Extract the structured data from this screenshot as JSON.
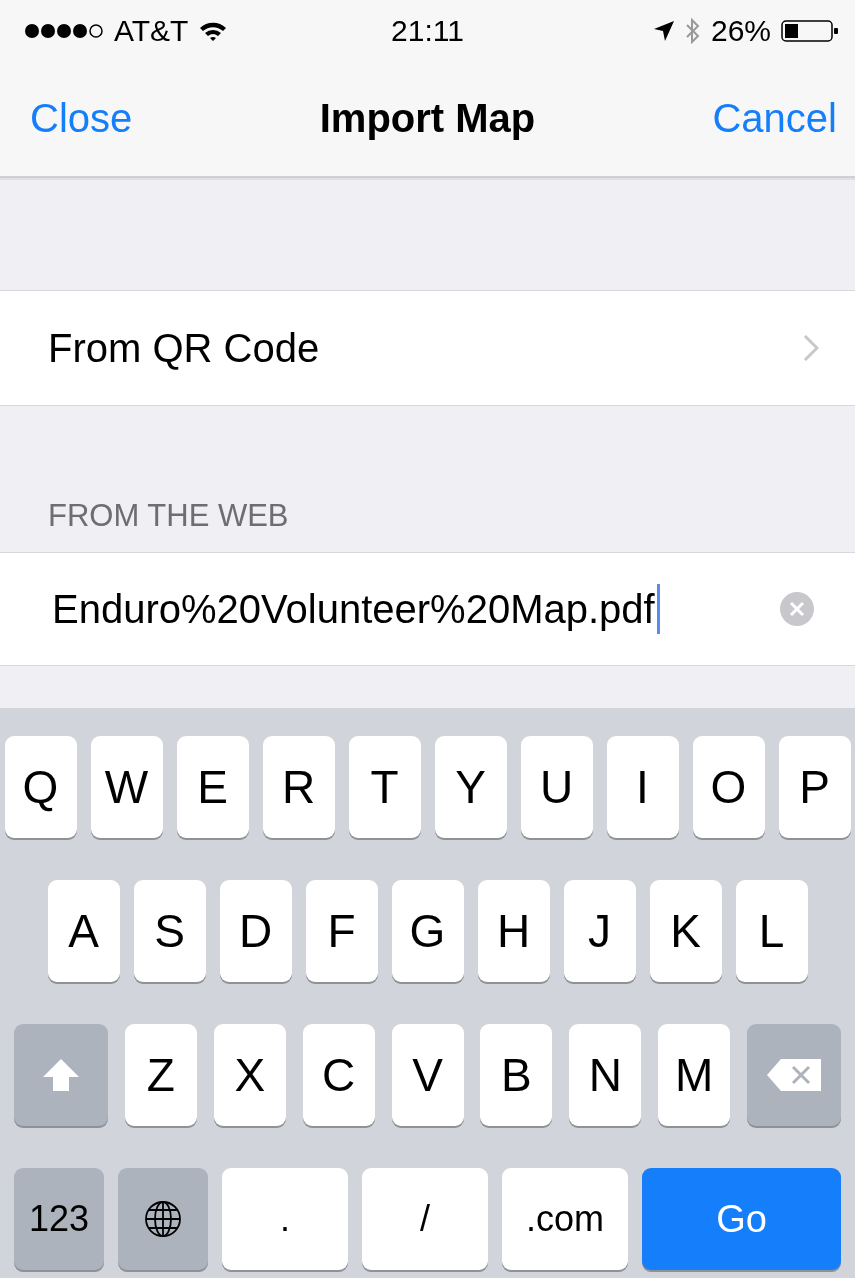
{
  "status_bar": {
    "carrier": "AT&T",
    "time": "21:11",
    "battery": "26%"
  },
  "nav_bar": {
    "left": "Close",
    "title": "Import Map",
    "right": "Cancel"
  },
  "rows": [
    {
      "label": "From QR Code",
      "kind": "disclosure"
    }
  ],
  "web_section": {
    "header": "FROM THE WEB",
    "url_field": {
      "value": "Enduro%20Volunteer%20Map.pdf"
    }
  },
  "keyboard": {
    "key_rows": [
      {
        "keys": [
          {
            "kind": "letter",
            "label": "Q"
          },
          {
            "kind": "letter",
            "label": "W"
          },
          {
            "kind": "letter",
            "label": "E"
          },
          {
            "kind": "letter",
            "label": "R"
          },
          {
            "kind": "letter",
            "label": "T"
          },
          {
            "kind": "letter",
            "label": "Y"
          },
          {
            "kind": "letter",
            "label": "U"
          },
          {
            "kind": "letter",
            "label": "I"
          },
          {
            "kind": "letter",
            "label": "O"
          },
          {
            "kind": "letter",
            "label": "P"
          }
        ]
      },
      {
        "keys": [
          {
            "kind": "letter",
            "label": "A"
          },
          {
            "kind": "letter",
            "label": "S"
          },
          {
            "kind": "letter",
            "label": "D"
          },
          {
            "kind": "letter",
            "label": "F"
          },
          {
            "kind": "letter",
            "label": "G"
          },
          {
            "kind": "letter",
            "label": "H"
          },
          {
            "kind": "letter",
            "label": "J"
          },
          {
            "kind": "letter",
            "label": "K"
          },
          {
            "kind": "letter",
            "label": "L"
          }
        ]
      },
      {
        "keys": [
          {
            "kind": "shift"
          },
          {
            "kind": "letter",
            "label": "Z"
          },
          {
            "kind": "letter",
            "label": "X"
          },
          {
            "kind": "letter",
            "label": "C"
          },
          {
            "kind": "letter",
            "label": "V"
          },
          {
            "kind": "letter",
            "label": "B"
          },
          {
            "kind": "letter",
            "label": "N"
          },
          {
            "kind": "letter",
            "label": "M"
          },
          {
            "kind": "delete"
          }
        ]
      },
      {
        "keys": [
          {
            "kind": "mode",
            "label": "123"
          },
          {
            "kind": "globe"
          },
          {
            "kind": "symbol",
            "label": "."
          },
          {
            "kind": "symbol",
            "label": "/"
          },
          {
            "kind": "symbol",
            "label": ".com"
          },
          {
            "kind": "go",
            "label": "Go"
          }
        ]
      }
    ]
  }
}
